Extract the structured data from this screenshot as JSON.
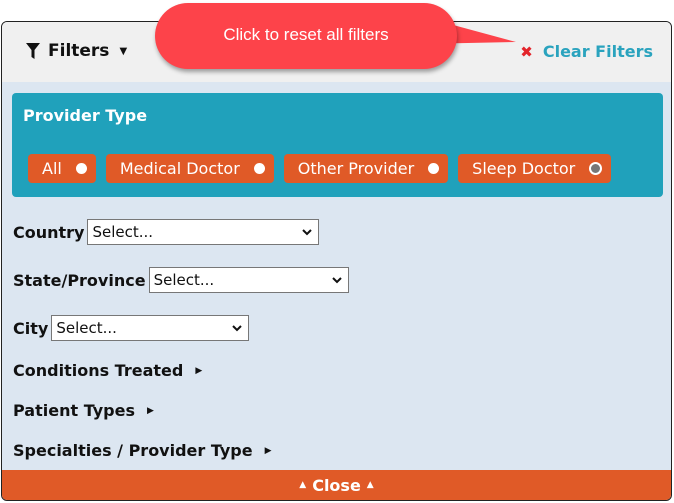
{
  "header": {
    "filters_label": "Filters",
    "filters_icon": "funnel-icon",
    "clear_filters_label": "Clear Filters",
    "clear_icon": "close-x-icon"
  },
  "callout": {
    "text": "Click to reset all filters",
    "color": "#fd434a"
  },
  "provider_type": {
    "title": "Provider Type",
    "options": [
      {
        "label": "All",
        "selected": true
      },
      {
        "label": "Medical Doctor",
        "selected": true
      },
      {
        "label": "Other Provider",
        "selected": true
      },
      {
        "label": "Sleep Doctor",
        "selected": false
      }
    ]
  },
  "fields": [
    {
      "label": "Country",
      "value": "Select..."
    },
    {
      "label": "State/Province",
      "value": "Select..."
    },
    {
      "label": "City",
      "value": "Select..."
    }
  ],
  "collapsibles": [
    {
      "label": "Conditions Treated"
    },
    {
      "label": "Patient Types"
    },
    {
      "label": "Specialties / Provider Type"
    }
  ],
  "footer": {
    "close_label": "Close"
  },
  "colors": {
    "accent_orange": "#e05a27",
    "teal": "#20a1bb",
    "link": "#2aa3be",
    "panel_bg": "#dce6f1"
  }
}
